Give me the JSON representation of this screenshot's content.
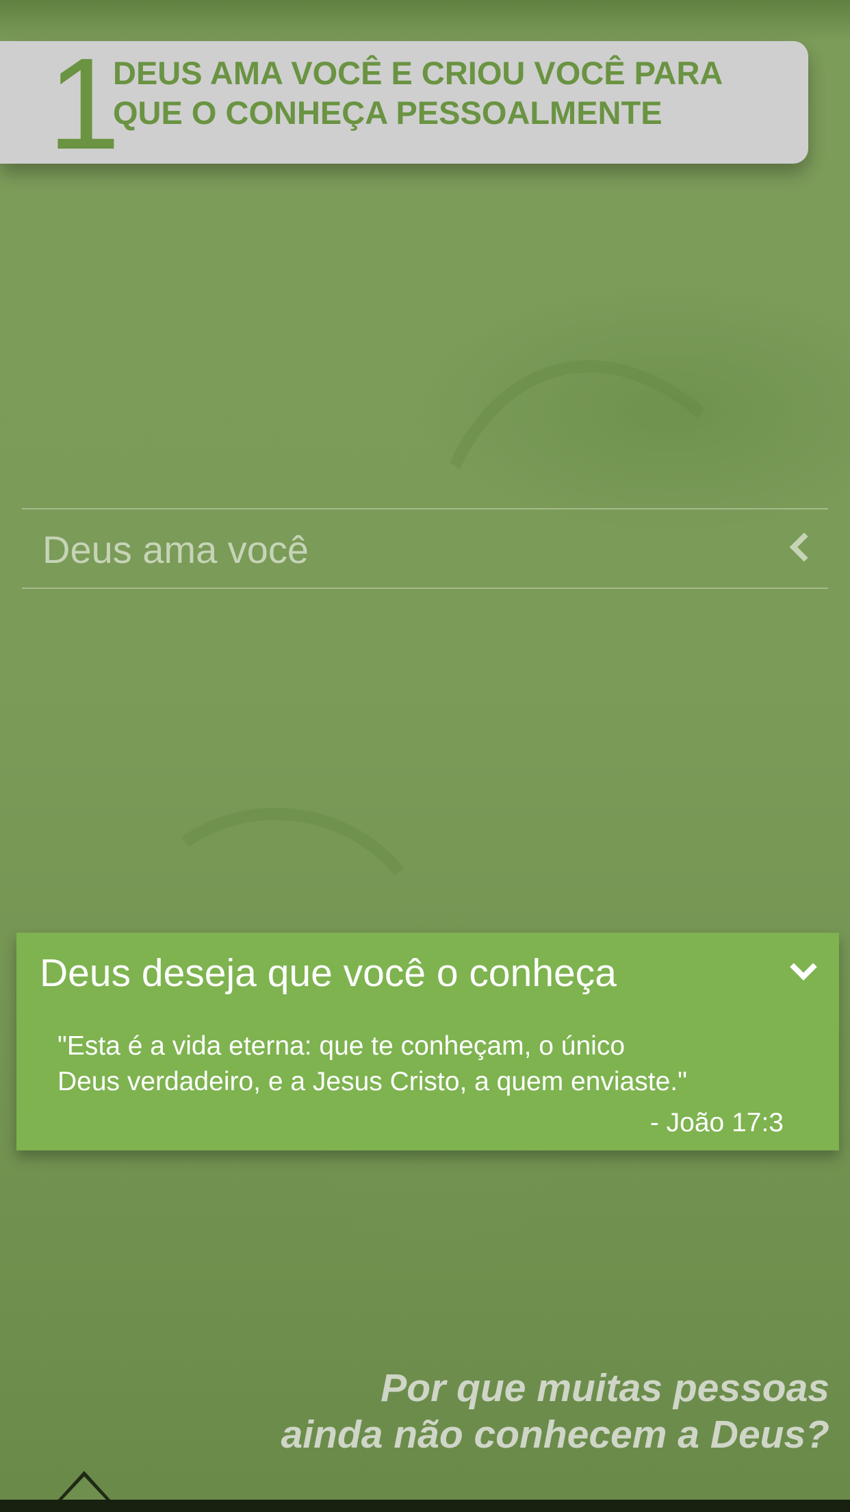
{
  "header": {
    "step_number": "1",
    "title": "DEUS AMA VOCÊ E CRIOU VOCÊ PARA\nQUE O CONHEÇA PESSOALMENTE"
  },
  "section": {
    "label": "Deus ama você",
    "icon": "chevron-left-icon"
  },
  "card": {
    "title": "Deus deseja que você o conheça",
    "icon": "chevron-down-icon",
    "quote": "\"Esta é a vida eterna: que te conheçam, o único\nDeus verdadeiro, e a Jesus Cristo, a quem enviaste.\"",
    "reference": "- João 17:3"
  },
  "next": {
    "question": "Por que muitas pessoas\nainda não conhecem a Deus?",
    "icon": "up-arrow-icon"
  },
  "colors": {
    "background": "#7a9a58",
    "accent": "#6a9342",
    "card": "#7eb350",
    "header_card": "#cfcfcf"
  }
}
